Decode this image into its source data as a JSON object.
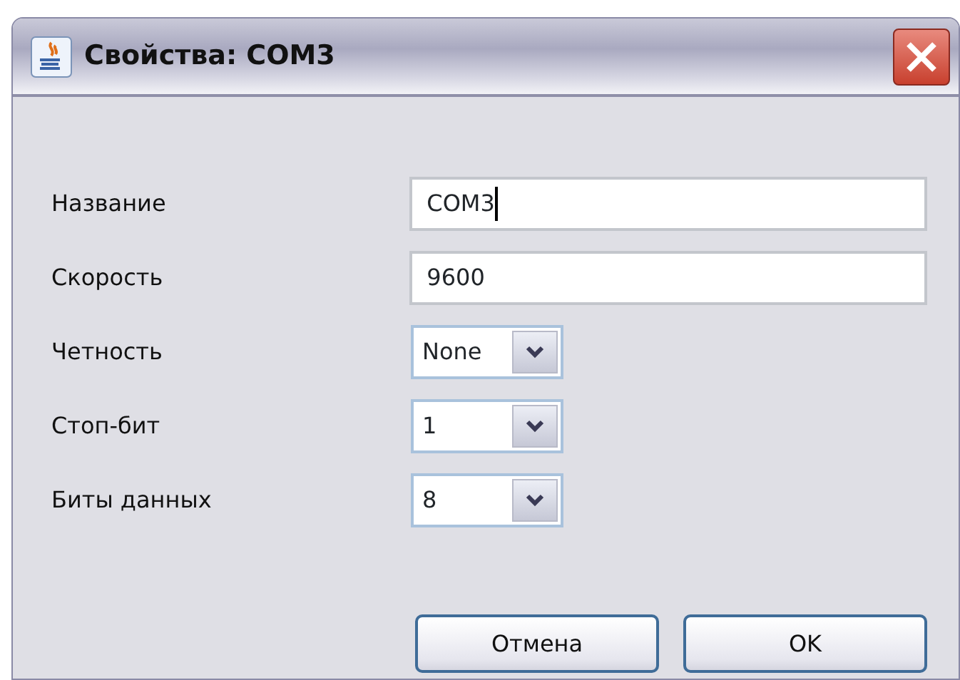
{
  "window": {
    "title": "Свойства: COM3"
  },
  "fields": [
    {
      "label": "Название",
      "kind": "text",
      "value": "COM3",
      "focused": true
    },
    {
      "label": "Скорость",
      "kind": "text",
      "value": "9600",
      "focused": false
    },
    {
      "label": "Четность",
      "kind": "combo",
      "value": "None"
    },
    {
      "label": "Стоп-бит",
      "kind": "combo",
      "value": "1"
    },
    {
      "label": "Биты данных",
      "kind": "combo",
      "value": "8"
    }
  ],
  "buttons": [
    "Отмена",
    "OK"
  ]
}
